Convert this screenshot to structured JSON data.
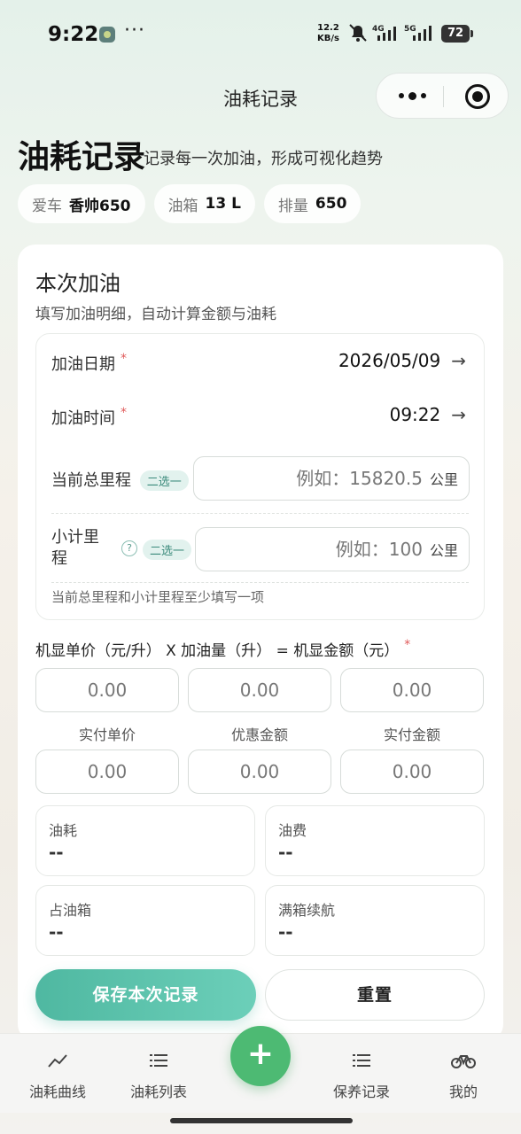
{
  "status_bar": {
    "time": "9:22",
    "speed_top": "12.2",
    "speed_unit": "KB/s",
    "net1": "4G",
    "net2": "5G",
    "battery": "72"
  },
  "nav": {
    "title": "油耗记录"
  },
  "header": {
    "title": "油耗记录",
    "subtitle": "记录每一次加油，形成可视化趋势",
    "chips": [
      {
        "key": "爱车",
        "value": "香帅650"
      },
      {
        "key": "油箱",
        "value": "13 L"
      },
      {
        "key": "排量",
        "value": "650"
      }
    ]
  },
  "card": {
    "title": "本次加油",
    "subtitle": "填写加油明细，自动计算金额与油耗",
    "date_label": "加油日期",
    "date_value": "2026/05/09",
    "time_label": "加油时间",
    "time_value": "09:22",
    "required_mark": "*",
    "odometer_label": "当前总里程",
    "odometer_pill": "二选一",
    "odometer_placeholder": "例如：15820.5",
    "odometer_unit": "公里",
    "trip_label": "小计里程",
    "trip_pill": "二选一",
    "trip_help": "?",
    "trip_placeholder": "例如：100",
    "trip_unit": "公里",
    "note": "当前总里程和小计里程至少填写一项",
    "price_title": "机显单价（元/升） X 加油量（升） = 机显金额（元）",
    "row1": [
      "0.00",
      "0.00",
      "0.00"
    ],
    "row2_labels": [
      "实付单价",
      "优惠金额",
      "实付金额"
    ],
    "row2": [
      "0.00",
      "0.00",
      "0.00"
    ],
    "stats": [
      {
        "key": "油耗",
        "value": "--"
      },
      {
        "key": "油费",
        "value": "--"
      },
      {
        "key": "占油箱",
        "value": "--"
      },
      {
        "key": "满箱续航",
        "value": "--"
      }
    ],
    "save_label": "保存本次记录",
    "reset_label": "重置"
  },
  "tabbar": {
    "items": [
      {
        "label": "油耗曲线",
        "icon": "trend-icon"
      },
      {
        "label": "油耗列表",
        "icon": "list-icon"
      },
      {
        "label": "保养记录",
        "icon": "list-icon"
      },
      {
        "label": "我的",
        "icon": "bicycle-icon"
      }
    ],
    "fab": "+"
  },
  "colors": {
    "accent": "#4fb8a1",
    "fab": "#4dba73",
    "required": "#e05a5a"
  }
}
